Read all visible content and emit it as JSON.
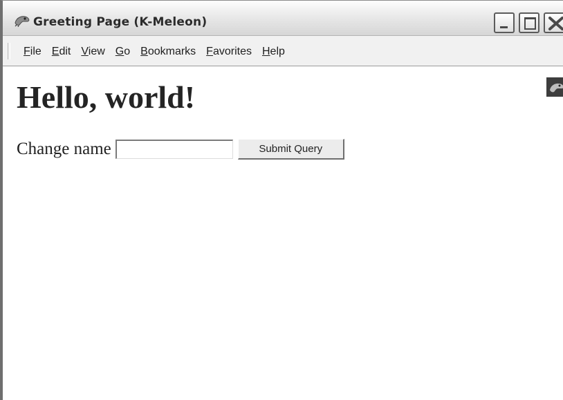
{
  "window": {
    "title": "Greeting Page (K-Meleon)"
  },
  "menubar": {
    "items": [
      {
        "label": "File",
        "accel": "F",
        "rest": "ile"
      },
      {
        "label": "Edit",
        "accel": "E",
        "rest": "dit"
      },
      {
        "label": "View",
        "accel": "V",
        "rest": "iew"
      },
      {
        "label": "Go",
        "accel": "G",
        "rest": "o"
      },
      {
        "label": "Bookmarks",
        "accel": "B",
        "rest": "ookmarks"
      },
      {
        "label": "Favorites",
        "accel": "F",
        "rest": "avorites"
      },
      {
        "label": "Help",
        "accel": "H",
        "rest": "elp"
      }
    ]
  },
  "page": {
    "heading": "Hello, world!",
    "form": {
      "label": "Change name",
      "input_value": "",
      "submit_label": "Submit Query"
    }
  },
  "icons": {
    "app": "k-meleon-icon",
    "throbber": "throbber-icon",
    "minimize": "minimize-icon",
    "maximize": "maximize-icon",
    "close": "close-icon"
  }
}
